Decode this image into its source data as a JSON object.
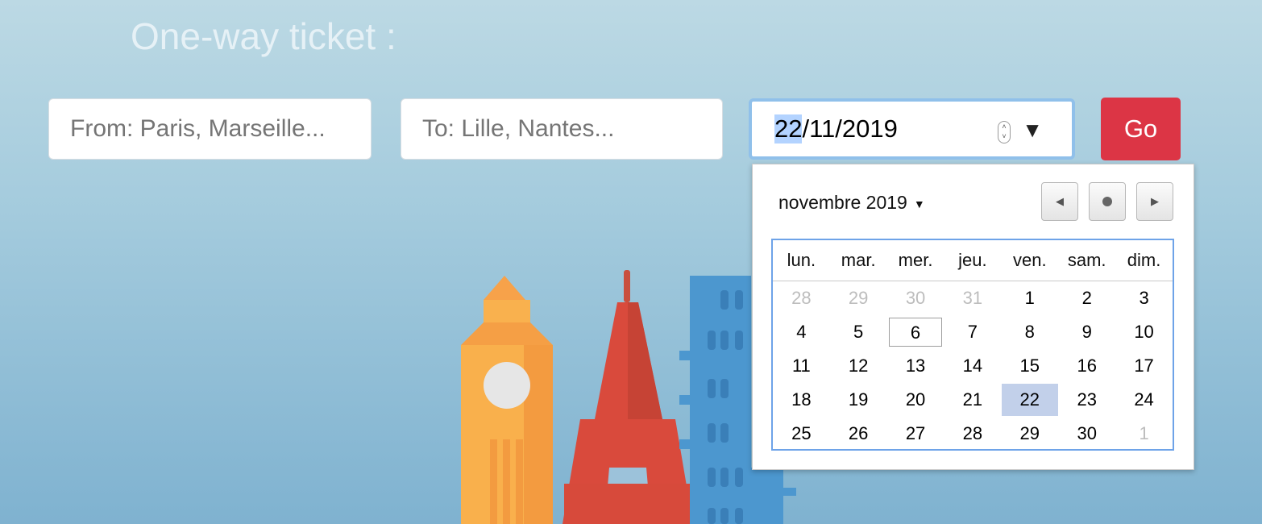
{
  "header": {
    "title": "One-way ticket :"
  },
  "form": {
    "from_placeholder": "From: Paris, Marseille...",
    "to_placeholder": "To: Lille, Nantes...",
    "date_day": "22",
    "date_rest": "/11/2019",
    "go_label": "Go"
  },
  "calendar": {
    "month_label": "novembre 2019",
    "weekdays": [
      "lun.",
      "mar.",
      "mer.",
      "jeu.",
      "ven.",
      "sam.",
      "dim."
    ],
    "weeks": [
      [
        "28",
        "29",
        "30",
        "31",
        "1",
        "2",
        "3"
      ],
      [
        "4",
        "5",
        "6",
        "7",
        "8",
        "9",
        "10"
      ],
      [
        "11",
        "12",
        "13",
        "14",
        "15",
        "16",
        "17"
      ],
      [
        "18",
        "19",
        "20",
        "21",
        "22",
        "23",
        "24"
      ],
      [
        "25",
        "26",
        "27",
        "28",
        "29",
        "30",
        "1"
      ]
    ],
    "today": "6",
    "selected": "22"
  },
  "colors": {
    "go_button": "#dc3545",
    "selected_day": "#c2d0ea",
    "focus_ring": "#90c0ea"
  },
  "icons": {
    "month_dropdown": "caret-down-icon",
    "prev": "triangle-left-icon",
    "today": "dot-icon",
    "next": "triangle-right-icon"
  }
}
